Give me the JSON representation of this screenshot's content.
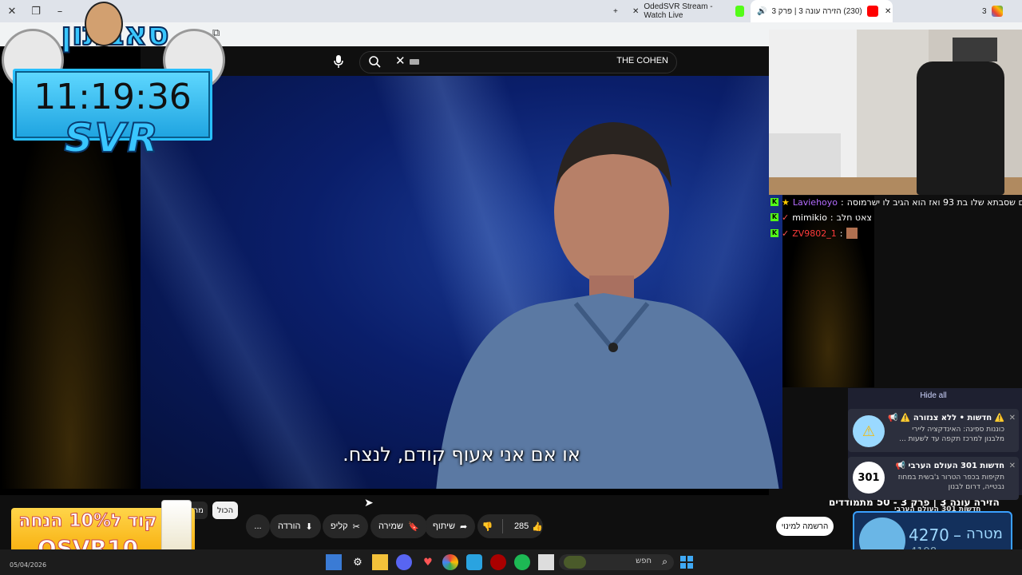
{
  "browser": {
    "tabs": [
      {
        "label": "OdedSVR Stream - Watch Live"
      },
      {
        "label": "(230) הזירה עונה 3 | פרק 3"
      },
      {
        "label": "3"
      }
    ],
    "new_tab": "+",
    "close_x": "✕"
  },
  "youtube": {
    "search_value": "THE COHEN",
    "subtitle": "או אם אני אעוף קודם, לנצח.",
    "like_count": "285",
    "share_label": "שיתוף",
    "save_label": "שמירה",
    "clip_label": "קליפ",
    "download_label": "הורדה",
    "more_label": "...",
    "subscribe_label": "הרשמה למינוי",
    "chip_all": "הכול",
    "chip_other": "מהס",
    "below_title": "הזירה עונה 3 | פרק 3 - 50 מתמודדים"
  },
  "overlay": {
    "channel_logo": "סאבתון",
    "clock_time": "11:19:36",
    "brand": "SVR",
    "promo_line1": "קוד ל10% הנחה",
    "promo_line2": "OSVR10",
    "date": "05/04/2026"
  },
  "chat": [
    {
      "user": "Laviehoyo",
      "message": "רשם שסבתא שלו בת 93 ואז הוא הגיב לו ישרמוסה",
      "user_color": "#b46cff"
    },
    {
      "user": "mimikio",
      "message": "צאט חלב",
      "user_color": "#ffffff"
    },
    {
      "user": "ZV9802_1",
      "message": "",
      "user_color": "#ff3b3b"
    }
  ],
  "notifications": {
    "hide_all": "Hide all",
    "items": [
      {
        "title": "⚠️ חדשות • ללא צנזורה ⚠️ 📢",
        "body": "כוננות ספיגה: האינדקציה ליירי מלבנון למרכז תקפה עד לשעות ..."
      },
      {
        "title": "חדשות 301 העולם הערבי 📢",
        "body": "תקיפות בכפר הטרור ג'בשית במחוז נבטייה, דרום לבנון"
      },
      {
        "title": "חדשות 301 העולם הערבי",
        "body": ""
      }
    ],
    "logo_301": "301"
  },
  "goal": {
    "label": "מטרה",
    "target": "4270",
    "dash": "–",
    "current": "4198"
  },
  "taskbar": {
    "search_placeholder": "חפש"
  },
  "colors": {
    "accent_blue": "#29c0ff",
    "kick_green": "#53fc18",
    "youtube_red": "#ff0000"
  }
}
